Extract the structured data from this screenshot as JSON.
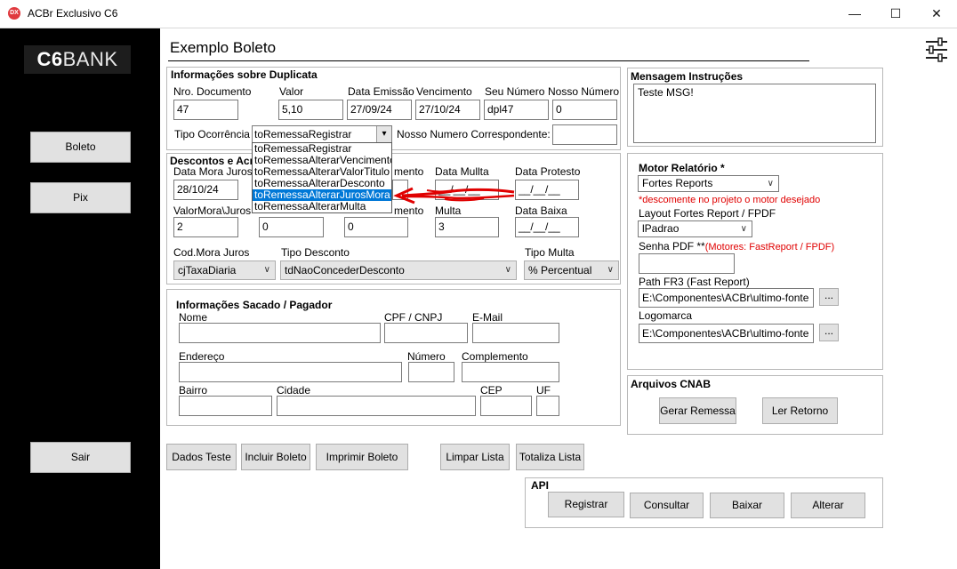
{
  "window": {
    "title": "ACBr Exclusivo C6",
    "icon_text": "DX",
    "minimize_glyph": "—",
    "maximize_glyph": "☐",
    "close_glyph": "✕"
  },
  "logo": {
    "bold": "C6",
    "rest": "BANK"
  },
  "sidebar": {
    "boleto": "Boleto",
    "pix": "Pix",
    "sair": "Sair"
  },
  "header": {
    "title": "Exemplo Boleto",
    "settings_glyph": "⚙"
  },
  "duplicata": {
    "title": "Informações sobre Duplicata",
    "nro_documento": {
      "label": "Nro. Documento",
      "value": "47"
    },
    "valor": {
      "label": "Valor",
      "value": "5,10"
    },
    "data_emissao": {
      "label": "Data Emissão",
      "value": "27/09/24"
    },
    "vencimento": {
      "label": "Vencimento",
      "value": "27/10/24"
    },
    "seu_numero": {
      "label": "Seu Número",
      "value": "dpl47"
    },
    "nosso_numero": {
      "label": "Nosso Número",
      "value": "0"
    },
    "tipo_ocorrencia": {
      "label": "Tipo Ocorrência",
      "value": "toRemessaRegistrar"
    },
    "nosso_numero_corr": {
      "label": "Nosso Numero Correspondente:",
      "value": ""
    }
  },
  "ocorrencia_options": [
    "toRemessaRegistrar",
    "toRemessaAlterarVencimento",
    "toRemessaAlterarValorTitulo",
    "toRemessaAlterarDesconto",
    "toRemessaAlterarJurosMora",
    "toRemessaAlterarMulta"
  ],
  "descontos": {
    "title": "Descontos e Acré",
    "data_mora_juros": {
      "label": "Data Mora Juros",
      "value": "28/10/24"
    },
    "data_desconto_label": "mento",
    "data_multa": {
      "label": "Data Mullta",
      "value": "__/__/__"
    },
    "data_protesto": {
      "label": "Data Protesto",
      "value": "__/__/__"
    },
    "valor_mora_juros": {
      "label": "ValorMora\\Juros",
      "value": "2"
    },
    "valor_desconto_value": "0",
    "valor_abatimento_label": "mento",
    "valor_abatimento_value": "0",
    "multa": {
      "label": "Multa",
      "value": "3"
    },
    "data_baixa": {
      "label": "Data Baixa",
      "value": "__/__/__"
    },
    "cod_mora_juros": {
      "label": "Cod.Mora Juros",
      "value": "cjTaxaDiaria"
    },
    "tipo_desconto": {
      "label": "Tipo Desconto",
      "value": "tdNaoConcederDesconto"
    },
    "tipo_multa": {
      "label": "Tipo Multa",
      "value": "% Percentual"
    }
  },
  "sacado": {
    "title": "Informações Sacado / Pagador",
    "nome": "Nome",
    "cpf": "CPF / CNPJ",
    "email": "E-Mail",
    "endereco": "Endereço",
    "numero": "Número",
    "complemento": "Complemento",
    "bairro": "Bairro",
    "cidade": "Cidade",
    "cep": "CEP",
    "uf": "UF"
  },
  "actions": {
    "dados_teste": "Dados Teste",
    "incluir_boleto": "Incluir Boleto",
    "imprimir_boleto": "Imprimir Boleto",
    "limpar_lista": "Limpar Lista",
    "totaliza_lista": "Totaliza Lista"
  },
  "api": {
    "title": "API",
    "registrar": "Registrar",
    "consultar": "Consultar",
    "baixar": "Baixar",
    "alterar": "Alterar"
  },
  "mensagem": {
    "title": "Mensagem Instruções",
    "value": "Teste MSG!"
  },
  "motor": {
    "title": "Motor Relatório *",
    "value": "Fortes Reports",
    "note": "*descomente no projeto o motor desejado",
    "layout_label": "Layout Fortes Report / FPDF",
    "layout_value": "lPadrao",
    "senha_label": "Senha PDF **",
    "senha_note": "(Motores: FastReport / FPDF)",
    "path_label": "Path FR3 (Fast Report)",
    "path_value": "E:\\Componentes\\ACBr\\ultimo-fonte",
    "logomarca_label": "Logomarca",
    "logomarca_value": "E:\\Componentes\\ACBr\\ultimo-fonte",
    "browse": "..."
  },
  "cnab": {
    "title": "Arquivos CNAB",
    "gerar": "Gerar Remessa",
    "ler": "Ler Retorno"
  },
  "colors": {
    "selection": "#0078d7",
    "annotation": "#e00000",
    "sidebar": "#000000"
  }
}
